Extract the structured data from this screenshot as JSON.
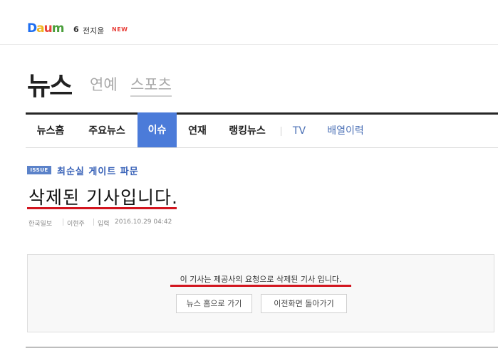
{
  "topbar": {
    "logo": [
      "D",
      "a",
      "u",
      "m"
    ],
    "logo_colors": [
      "#1e6ef0",
      "#f0b41e",
      "#e8403a",
      "#4a9e3b"
    ],
    "rank": "6",
    "keyword": "전지윤",
    "badge": "NEW"
  },
  "header": {
    "section": "뉴스",
    "sub_links": [
      "연예",
      "스포츠"
    ]
  },
  "nav": {
    "items": [
      "뉴스홈",
      "주요뉴스",
      "이슈",
      "연재",
      "랭킹뉴스",
      "TV",
      "배열이력"
    ],
    "active": "이슈"
  },
  "article": {
    "issue_badge": "ISSUE",
    "issue_title": "최순실 게이트 파문",
    "headline": "삭제된 기사입니다.",
    "source": "한국일보",
    "author": "이현주",
    "date_label": "입력",
    "date": "2016.10.29 04:42"
  },
  "notice": {
    "message": "이 기사는 제공사의 요청으로 삭제된 기사 입니다.",
    "home_button": "뉴스 홈으로 가기",
    "back_button": "이전화면 돌아가기"
  },
  "colors": {
    "accent": "#4b7bd9",
    "highlight": "#d2151f",
    "issue": "#3a63b8"
  }
}
